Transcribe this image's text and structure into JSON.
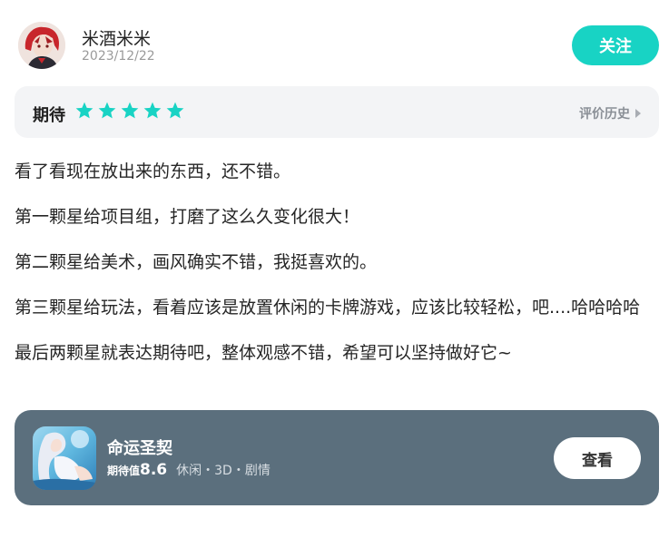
{
  "header": {
    "user_name": "米酒米米",
    "date": "2023/12/22",
    "follow_label": "关注",
    "avatar": "user-avatar"
  },
  "rating": {
    "label": "期待",
    "stars": 5,
    "max_stars": 5,
    "history_label": "评价历史",
    "accent": "#18d3c4"
  },
  "review": {
    "paragraphs": [
      "看了看现在放出来的东西，还不错。",
      "第一颗星给项目组，打磨了这么久变化很大！",
      "第二颗星给美术，画风确实不错，我挺喜欢的。",
      "第三颗星给玩法，看着应该是放置休闲的卡牌游戏，应该比较轻松，吧....哈哈哈哈",
      "最后两颗星就表达期待吧，整体观感不错，希望可以坚持做好它~"
    ]
  },
  "game": {
    "title": "命运圣契",
    "expect_label": "期待值",
    "expect_score": "8.6",
    "tags": "休闲・3D・剧情",
    "view_label": "查看",
    "card_color": "#5b6f7d"
  }
}
